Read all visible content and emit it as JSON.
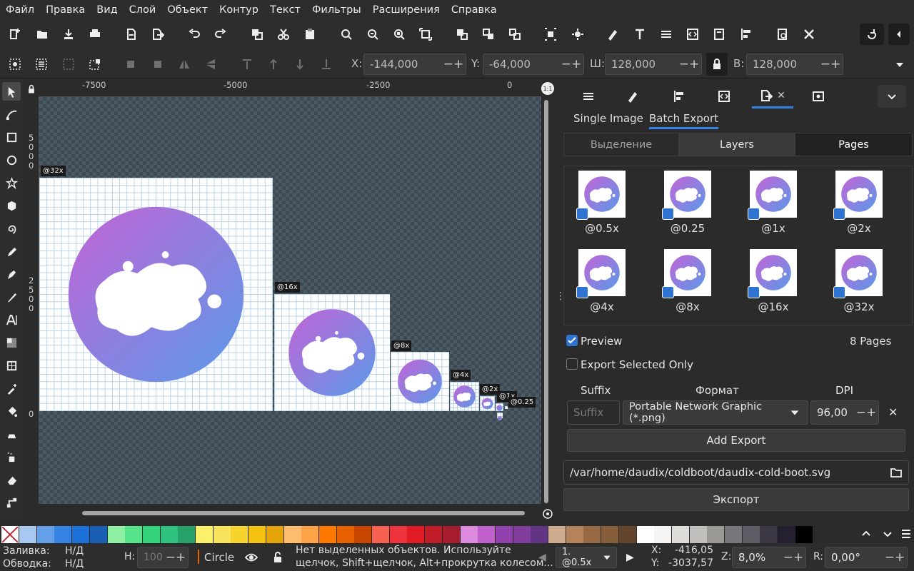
{
  "menu": [
    "Файл",
    "Правка",
    "Вид",
    "Слой",
    "Объект",
    "Контур",
    "Текст",
    "Фильтры",
    "Расширения",
    "Справка"
  ],
  "coords": {
    "x_label": "X:",
    "x_value": "-144,000",
    "y_label": "Y:",
    "y_value": "-64,000",
    "w_label": "Ш:",
    "w_value": "128,000",
    "h_label": "В:",
    "h_value": "128,000"
  },
  "ruler": {
    "top": [
      "-7500",
      "-5000",
      "-2500",
      "0"
    ],
    "left_a": [
      "5",
      "0",
      "0",
      "0"
    ],
    "left_b": [
      "2",
      "5",
      "0",
      "0"
    ],
    "left_c": "0"
  },
  "pages": [
    "@32x",
    "@16x",
    "@8x",
    "@4x",
    "@2x",
    "@1x",
    "@0.25"
  ],
  "dock": {
    "subtabs": [
      "Single Image",
      "Batch Export"
    ],
    "segments": [
      "Выделение",
      "Layers",
      "Pages"
    ],
    "thumbs": [
      "@0.5x",
      "@0.25",
      "@1x",
      "@2x",
      "@4x",
      "@8x",
      "@16x",
      "@32x"
    ],
    "preview_label": "Preview",
    "pages_count": "8 Pages",
    "export_selected_label": "Export Selected Only",
    "suffix_header": "Suffix",
    "format_header": "Формат",
    "dpi_header": "DPI",
    "suffix_placeholder": "Suffix",
    "format_value": "Portable Network Graphic (*.png)",
    "dpi_value": "96,00",
    "add_export": "Add Export",
    "filepath": "/var/home/daudix/coldboot/daudix-cold-boot.svg",
    "export_button": "Экспорт"
  },
  "palette": [
    "#a8c8f0",
    "#64a0e8",
    "#3584e4",
    "#1c71d8",
    "#1a5fb4",
    "#8ff0a4",
    "#57e389",
    "#33d17a",
    "#2ec27e",
    "#26a269",
    "#f9f06b",
    "#f8e45c",
    "#f6d32d",
    "#f5c211",
    "#e5a50a",
    "#ffbe6f",
    "#ffa348",
    "#ff7800",
    "#e66100",
    "#c64600",
    "#f66151",
    "#ed333b",
    "#e01b24",
    "#c01c28",
    "#a51d2d",
    "#dc8add",
    "#c061cb",
    "#9141ac",
    "#813d9c",
    "#613583",
    "#cdab8f",
    "#b5835a",
    "#986a44",
    "#865e3c",
    "#63452c",
    "#ffffff",
    "#f6f5f4",
    "#deddda",
    "#c0bfbc",
    "#9a9996",
    "#77767b",
    "#5e5c64",
    "#3d3846",
    "#241f31",
    "#000000"
  ],
  "status": {
    "fill_label": "Заливка:",
    "fill_value": "Н/Д",
    "stroke_label": "Обводка:",
    "stroke_value": "Н/Д",
    "h_label": "H:",
    "h_value": "100",
    "layer_name": "Circle",
    "message_1": "Нет выделенных объектов. Используйте",
    "message_2": "щелчок, Shift+щелчок, Alt+прокрутка колесом...",
    "page_select": "1. @0.5x",
    "x_label": "X:",
    "x_value": "-416,05",
    "y_label": "Y:",
    "y_value": "-3037,57",
    "zoom_label": "Z:",
    "zoom_value": "8,0%",
    "rot_label": "R:",
    "rot_value": "0,00°"
  }
}
